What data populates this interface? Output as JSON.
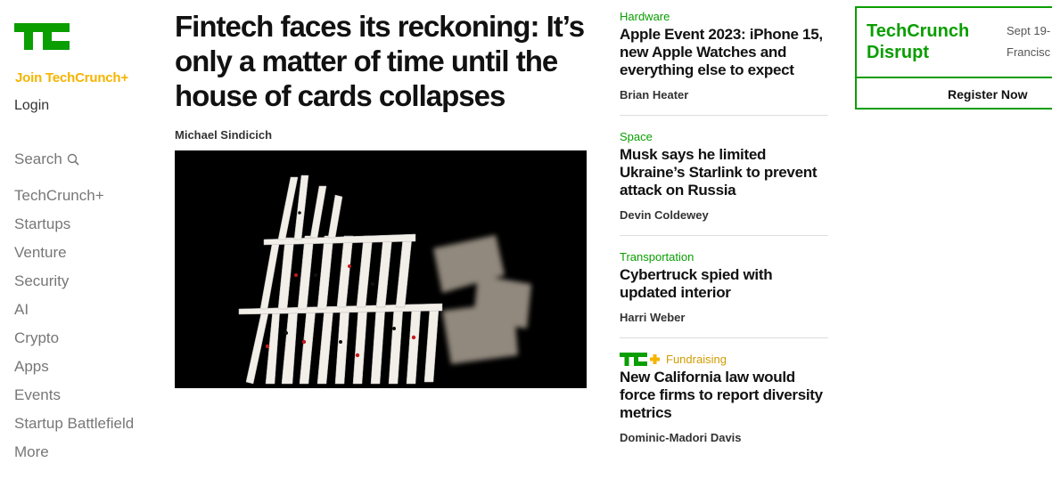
{
  "sidebar": {
    "join_label": "Join TechCrunch+",
    "login_label": "Login",
    "search_label": "Search",
    "nav_items": [
      {
        "label": "TechCrunch+"
      },
      {
        "label": "Startups"
      },
      {
        "label": "Venture"
      },
      {
        "label": "Security"
      },
      {
        "label": "AI"
      },
      {
        "label": "Crypto"
      },
      {
        "label": "Apps"
      },
      {
        "label": "Events"
      },
      {
        "label": "Startup Battlefield"
      },
      {
        "label": "More"
      }
    ]
  },
  "main_article": {
    "headline": "Fintech faces its reckoning: It’s only a matter of time until the house of cards collapses",
    "author": "Michael Sindicich"
  },
  "stories": [
    {
      "category": "Hardware",
      "title": "Apple Event 2023: iPhone 15, new Apple Watches and everything else to expect",
      "author": "Brian Heater"
    },
    {
      "category": "Space",
      "title": "Musk says he limited Ukraine’s Starlink to prevent attack on Russia",
      "author": "Devin Coldewey"
    },
    {
      "category": "Transportation",
      "title": "Cybertruck spied with updated interior",
      "author": "Harri Weber"
    },
    {
      "category": "Fundraising",
      "title": "New California law would force firms to report diversity metrics",
      "author": "Dominic-Madori Davis"
    }
  ],
  "ad": {
    "title_line1": "TechCrunch",
    "title_line2": "Disrupt",
    "date_line1": "Sept 19-",
    "date_line2": "Francisc",
    "button_label": "Register Now"
  },
  "colors": {
    "brand_green": "#0a9e01",
    "plus_yellow": "#f5b400"
  },
  "icons": [
    "tc-logo-icon",
    "search-icon",
    "tc-plus-icon"
  ]
}
